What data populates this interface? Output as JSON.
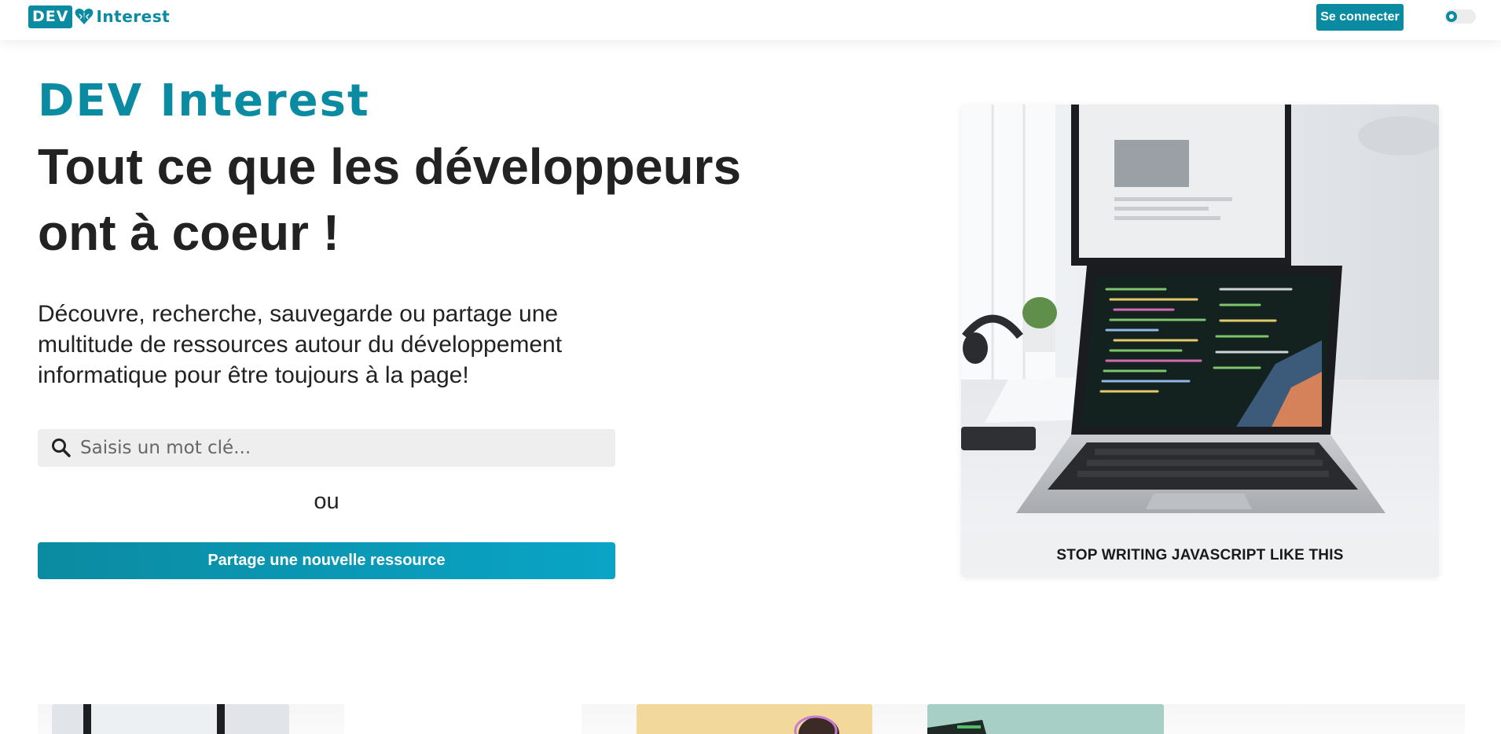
{
  "header": {
    "logo": {
      "dev": "DEV",
      "word": "Interest"
    },
    "login_button": "Se connecter",
    "theme_toggle": {
      "state": "dark-mode-off"
    }
  },
  "hero": {
    "brand": "DEV Interest",
    "headline": "Tout ce que les développeurs ont à coeur !",
    "description": "Découvre, recherche, sauvegarde ou partage une multitude de ressources autour du développement informatique pour être toujours à la page!",
    "search": {
      "placeholder": "Saisis un mot clé...",
      "value": ""
    },
    "or_text": "ou",
    "share_button": "Partage une nouvelle ressource"
  },
  "featured": {
    "caption": "STOP WRITING JAVASCRIPT LIKE THIS"
  },
  "colors": {
    "brand": "#0b8ba1",
    "brand_light": "#0aa4c6",
    "search_bg": "#eeeeee",
    "text": "#222222"
  },
  "icons": [
    "heart-logo-icon",
    "search-icon",
    "theme-toggle-icon"
  ]
}
